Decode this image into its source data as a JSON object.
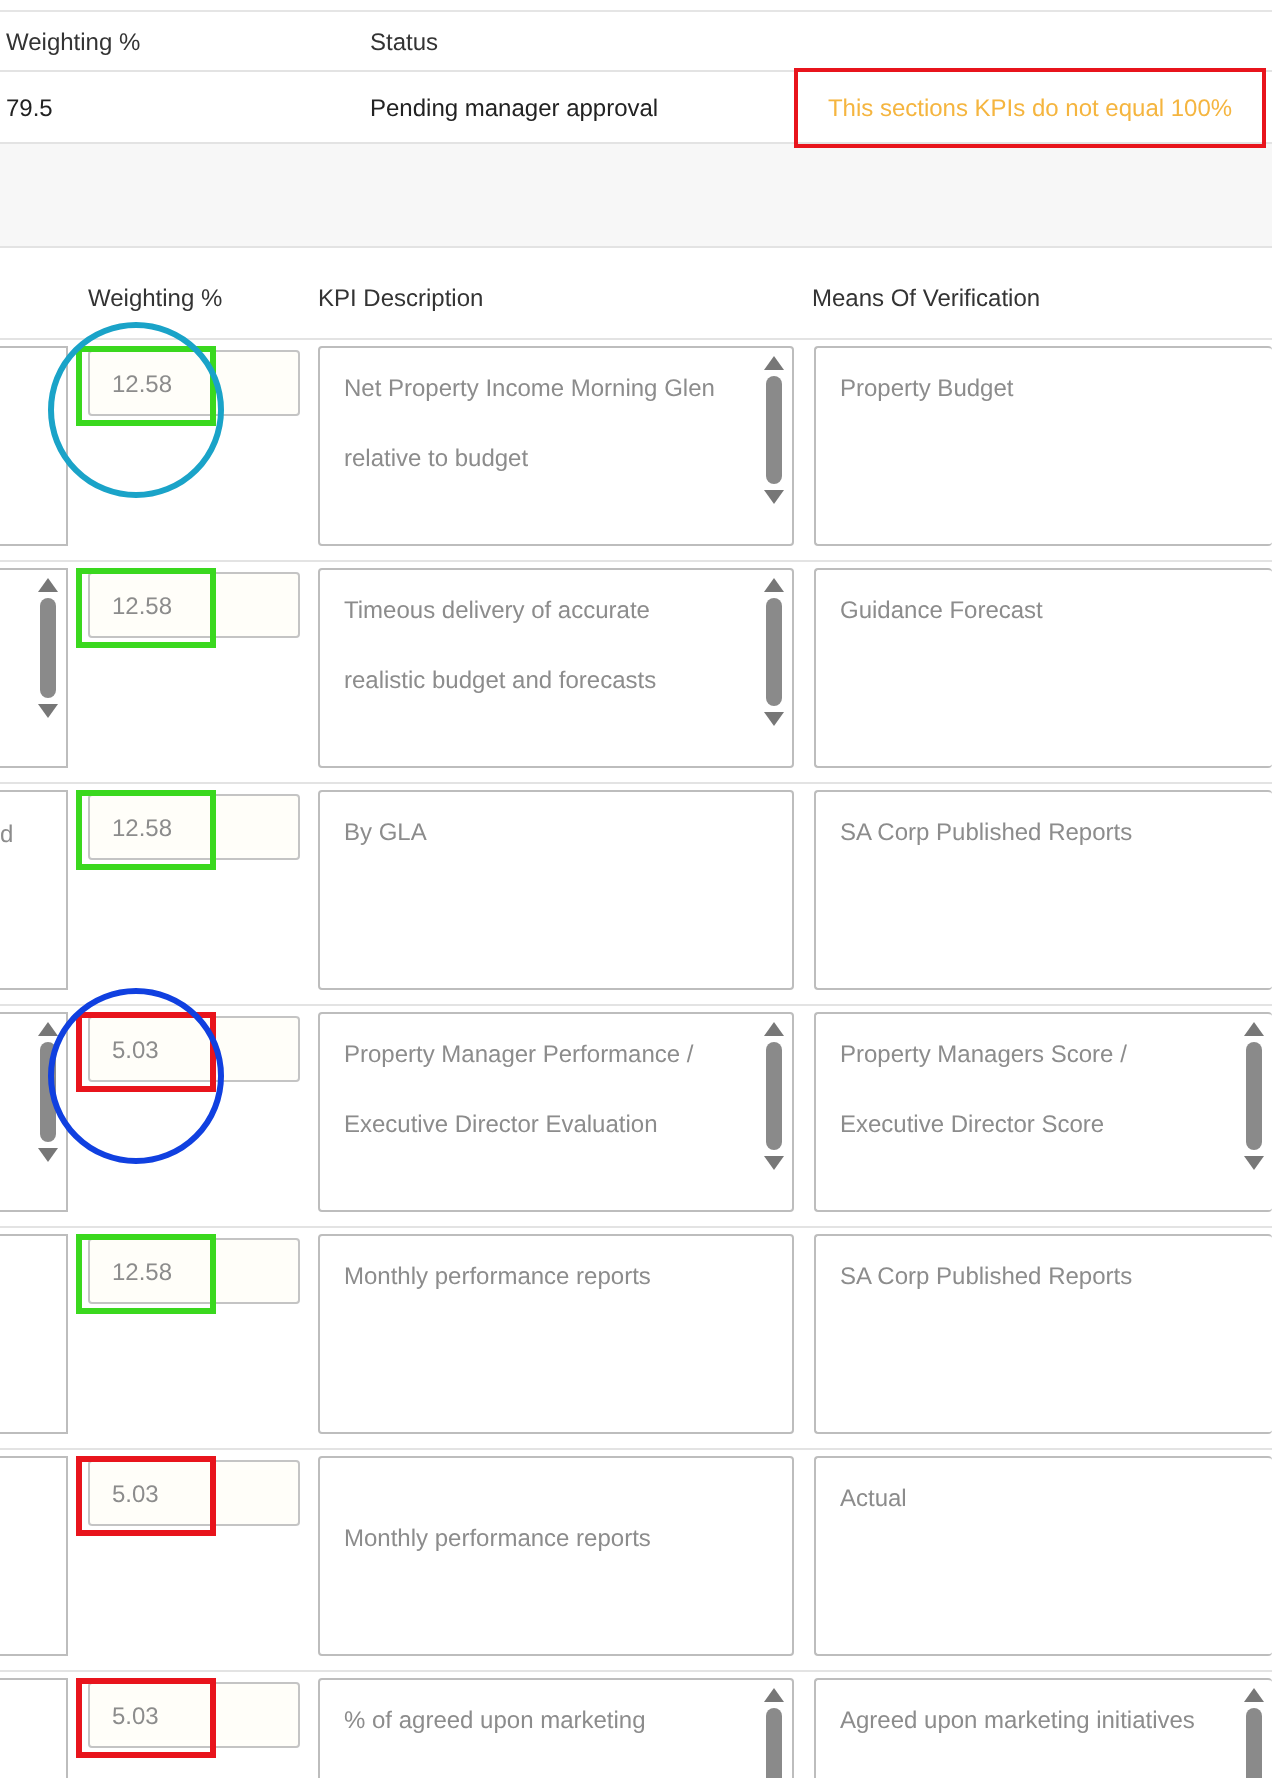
{
  "summary": {
    "columns": [
      "Weighting %",
      "Status"
    ],
    "values": [
      "79.5",
      "Pending manager approval"
    ],
    "warning": {
      "text": "This sections KPIs do not equal 100%",
      "highlight": {
        "color": "#e8141c"
      }
    }
  },
  "kpi_table": {
    "columns": [
      "Weighting %",
      "KPI Description",
      "Means Of Verification"
    ],
    "rows": [
      {
        "column_1": {
          "scrollbar": false
        },
        "weighting": "12.58",
        "highlight": {
          "color": "#3ad81e"
        },
        "circle": {
          "color": "#1aa3c8"
        },
        "description": {
          "lines": [
            "Net Property Income Morning Glen",
            "relative to budget"
          ],
          "kind": "top",
          "scrollbar": true
        },
        "verification": {
          "lines": [
            "Property Budget"
          ],
          "kind": "top",
          "scrollbar": false
        }
      },
      {
        "column_1": {
          "scrollbar": true
        },
        "weighting": "12.58",
        "highlight": {
          "color": "#3ad81e"
        },
        "description": {
          "lines": [
            "Timeous delivery of accurate",
            "realistic budget and forecasts"
          ],
          "kind": "top",
          "scrollbar": true
        },
        "verification": {
          "lines": [
            "Guidance Forecast"
          ],
          "kind": "top",
          "scrollbar": false
        }
      },
      {
        "column_1": {
          "text": "d",
          "scrollbar": false
        },
        "weighting": "12.58",
        "highlight": {
          "color": "#3ad81e"
        },
        "description": {
          "lines": [
            "By GLA"
          ],
          "kind": "top",
          "scrollbar": false
        },
        "verification": {
          "lines": [
            "SA Corp Published Reports"
          ],
          "kind": "top",
          "scrollbar": false
        }
      },
      {
        "column_1": {
          "scrollbar": true
        },
        "weighting": "5.03",
        "highlight": {
          "color": "#e8141c"
        },
        "circle": {
          "color": "#1040e0"
        },
        "description": {
          "lines": [
            "Property Manager Performance /",
            "Executive Director Evaluation"
          ],
          "kind": "top",
          "scrollbar": true
        },
        "verification": {
          "lines": [
            "Property Managers Score /",
            "Executive Director Score"
          ],
          "kind": "top",
          "scrollbar": true
        }
      },
      {
        "column_1": {
          "scrollbar": false
        },
        "weighting": "12.58",
        "highlight": {
          "color": "#3ad81e"
        },
        "description": {
          "lines": [
            "Monthly performance reports"
          ],
          "kind": "top",
          "scrollbar": false
        },
        "verification": {
          "lines": [
            "SA Corp Published Reports"
          ],
          "kind": "top",
          "scrollbar": false
        }
      },
      {
        "column_1": {
          "scrollbar": false
        },
        "weighting": "5.03",
        "highlight": {
          "color": "#e8141c"
        },
        "description": {
          "lines": [
            "Monthly performance reports"
          ],
          "kind": "middle",
          "scrollbar": false
        },
        "verification": {
          "lines": [
            "Actual"
          ],
          "kind": "top",
          "scrollbar": false
        }
      },
      {
        "column_1": {
          "scrollbar": false
        },
        "weighting": "5.03",
        "highlight": {
          "color": "#e8141c"
        },
        "description": {
          "lines": [
            "% of agreed upon marketing"
          ],
          "kind": "top",
          "scrollbar": true
        },
        "verification": {
          "lines": [
            "Agreed upon marketing initiatives"
          ],
          "kind": "top",
          "scrollbar": true
        }
      }
    ]
  }
}
